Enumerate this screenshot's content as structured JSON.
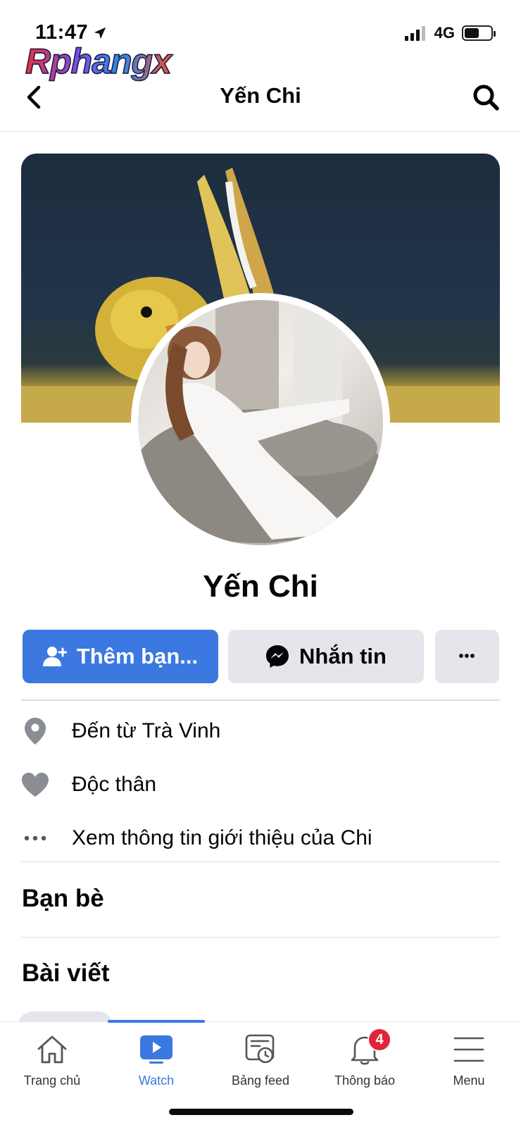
{
  "status_bar": {
    "time": "11:47",
    "network": "4G",
    "battery_level": 0.55
  },
  "watermark": {
    "text": "Rphangx"
  },
  "nav": {
    "title": "Yến Chi",
    "back_icon": "chevron-left-icon",
    "search_icon": "search-icon"
  },
  "profile": {
    "name": "Yến Chi",
    "colors": {
      "primary": "#3b78e0",
      "secondary_button": "#e4e6eb",
      "badge": "#e0243a"
    }
  },
  "actions": {
    "add_friend_label": "Thêm bạn...",
    "message_label": "Nhắn tin",
    "more_label": "•••"
  },
  "intro": {
    "hometown_prefix": "Đến từ ",
    "hometown_place": "Trà Vinh",
    "relationship": "Độc thân",
    "see_about": "Xem thông tin giới thiệu của Chi"
  },
  "sections": {
    "friends": "Bạn bè",
    "posts": "Bài viết"
  },
  "tab_bar": {
    "items": [
      {
        "label": "Trang chủ",
        "icon": "home-icon",
        "active": false
      },
      {
        "label": "Watch",
        "icon": "watch-icon",
        "active": true
      },
      {
        "label": "Bảng feed",
        "icon": "feed-icon",
        "active": false
      },
      {
        "label": "Thông báo",
        "icon": "bell-icon",
        "active": false,
        "badge": "4"
      },
      {
        "label": "Menu",
        "icon": "menu-icon",
        "active": false
      }
    ]
  }
}
